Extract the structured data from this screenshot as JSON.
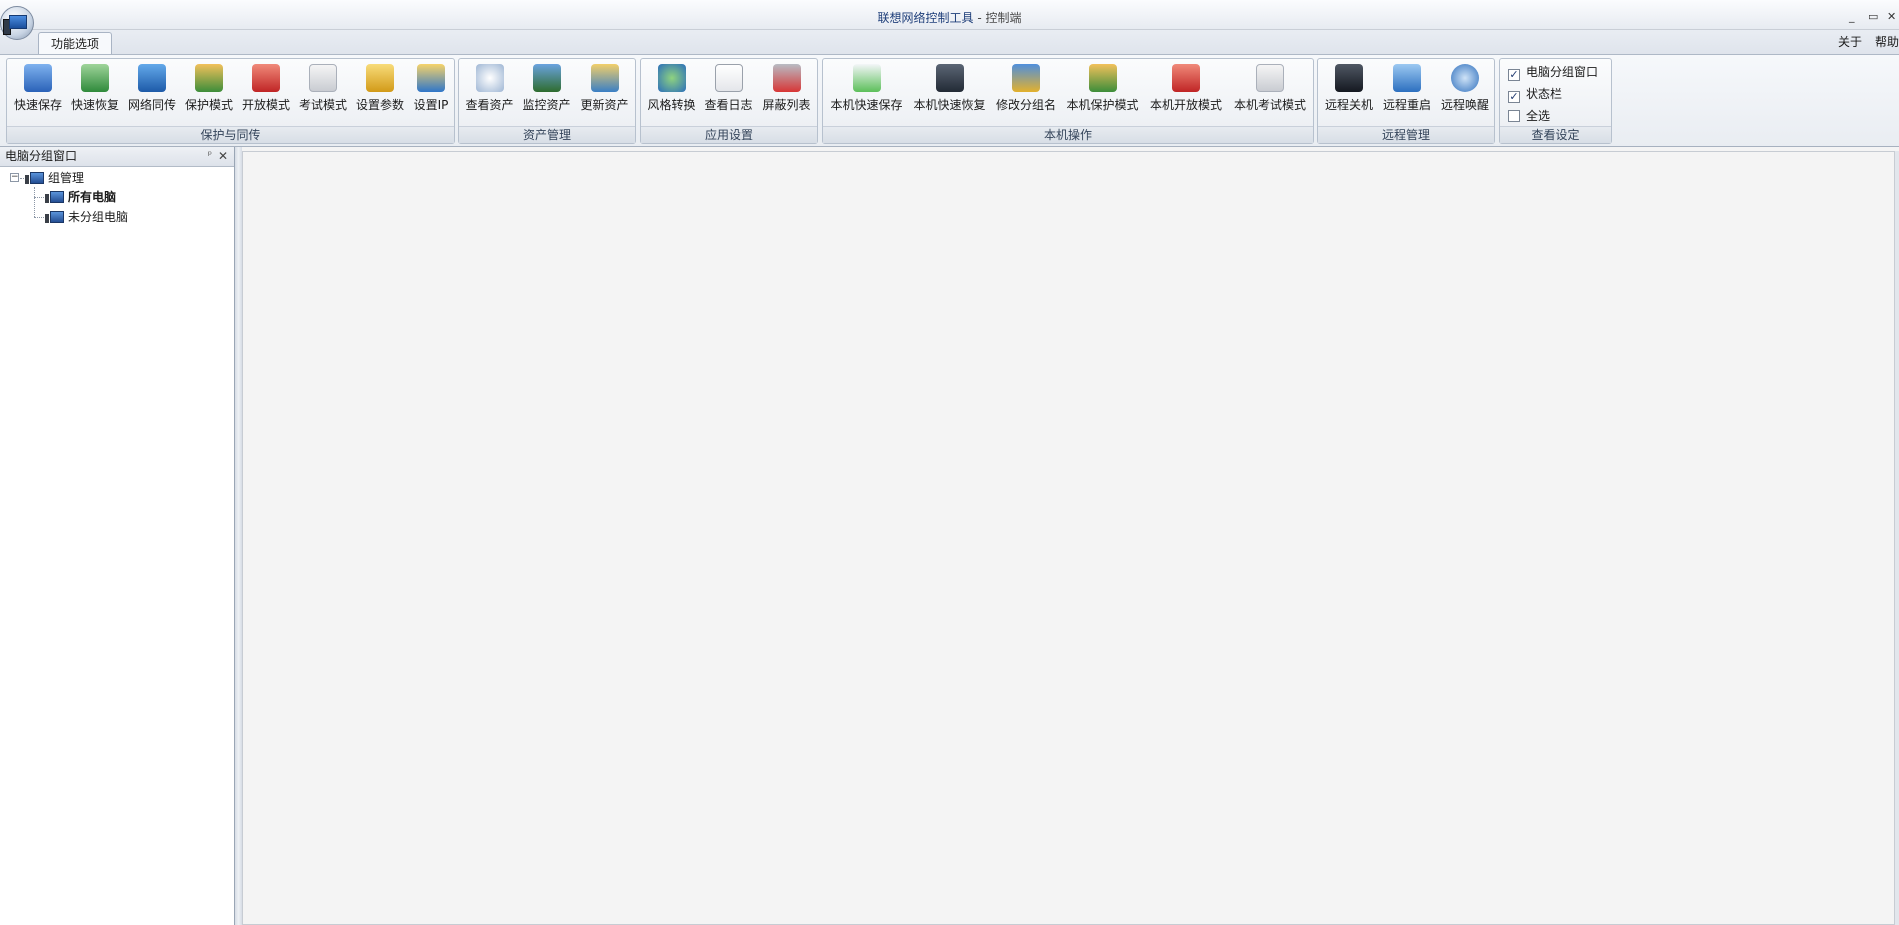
{
  "window": {
    "title_main": "联想网络控制工具",
    "title_suffix": " - 控制端",
    "minimize": "_",
    "maximize": "▭",
    "close": "✕"
  },
  "tabs": [
    {
      "label": "功能选项"
    }
  ],
  "top_links": {
    "about": "关于",
    "help": "帮助"
  },
  "ribbon": {
    "groups": [
      {
        "label": "保护与同传",
        "buttons": [
          "快速保存",
          "快速恢复",
          "网络同传",
          "保护模式",
          "开放模式",
          "考试模式",
          "设置参数",
          "设置IP"
        ]
      },
      {
        "label": "资产管理",
        "buttons": [
          "查看资产",
          "监控资产",
          "更新资产"
        ]
      },
      {
        "label": "应用设置",
        "buttons": [
          "风格转换",
          "查看日志",
          "屏蔽列表"
        ]
      },
      {
        "label": "本机操作",
        "buttons": [
          "本机快速保存",
          "本机快速恢复",
          "修改分组名",
          "本机保护模式",
          "本机开放模式",
          "本机考试模式"
        ]
      },
      {
        "label": "远程管理",
        "buttons": [
          "远程关机",
          "远程重启",
          "远程唤醒"
        ]
      },
      {
        "label": "查看设定",
        "checks": [
          {
            "label": "电脑分组窗口",
            "checked": true
          },
          {
            "label": "状态栏",
            "checked": true
          },
          {
            "label": "全选",
            "checked": false
          }
        ]
      }
    ]
  },
  "left_panel": {
    "title": "电脑分组窗口",
    "pin": "ᵖ",
    "close": "✕",
    "tree": {
      "expander": "−",
      "root": "组管理",
      "children": [
        "所有电脑",
        "未分组电脑"
      ]
    }
  }
}
